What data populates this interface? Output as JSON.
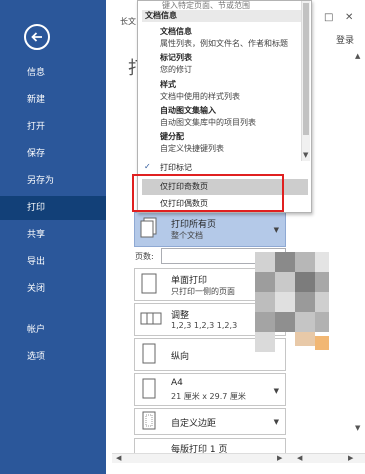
{
  "sidebar": {
    "items": [
      {
        "label": "信息"
      },
      {
        "label": "新建"
      },
      {
        "label": "打开"
      },
      {
        "label": "保存"
      },
      {
        "label": "另存为"
      },
      {
        "label": "打印"
      },
      {
        "label": "共享"
      },
      {
        "label": "导出"
      },
      {
        "label": "关闭"
      },
      {
        "label": "帐户"
      },
      {
        "label": "选项"
      }
    ]
  },
  "header": {
    "title_fragment": "长文",
    "heading_fragment": "打",
    "login": "登录",
    "minimize_glyph": "□",
    "close_glyph": "✕"
  },
  "dropdown": {
    "top_truncated": "键入特定页面、节或范围",
    "section_title": "文档信息",
    "entries": [
      {
        "title": "文档信息",
        "desc": "属性列表，例如文件名、作者和标题"
      },
      {
        "title": "标记列表",
        "desc": "您的修订"
      },
      {
        "title": "样式",
        "desc": "文档中使用的样式列表"
      },
      {
        "title": "自动图文集输入",
        "desc": "自动图文集库中的项目列表"
      },
      {
        "title": "键分配",
        "desc": "自定义快捷键列表"
      }
    ],
    "print_markup": "打印标记",
    "odd_pages": "仅打印奇数页",
    "even_pages": "仅打印偶数页"
  },
  "settings": {
    "print_all_title": "打印所有页",
    "print_all_desc": "整个文档",
    "pages_label": "页数:",
    "pages_value": "",
    "one_sided_title": "单面打印",
    "one_sided_desc": "只打印一侧的页面",
    "collate_title": "调整",
    "collate_desc": "1,2,3    1,2,3    1,2,3",
    "orientation_title": "纵向",
    "paper_title": "A4",
    "paper_desc": "21 厘米 x 29.7 厘米",
    "margins_title": "自定义边距",
    "pages_per_sheet_title": "每版打印 1 页"
  },
  "colors": {
    "sidebar": "#2b579a",
    "sidebar_active": "#124078",
    "highlight_box": "#e02020",
    "selected_row": "#cdcdcd"
  }
}
